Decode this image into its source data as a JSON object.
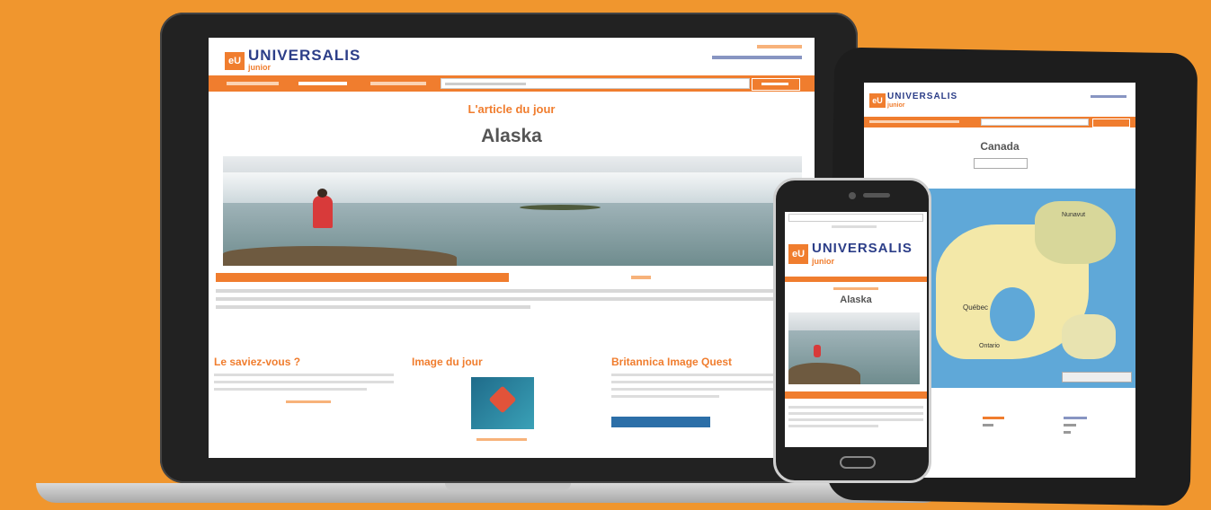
{
  "laptop": {
    "brand": "UNIVERSALIS",
    "brand_sub": "junior",
    "logo_mark": "eU",
    "title_article": "L'article du jour",
    "title_main": "Alaska",
    "section_left": "Le saviez-vous ?",
    "section_mid": "Image du jour",
    "section_right": "Britannica Image Quest"
  },
  "tablet": {
    "brand": "UNIVERSALIS",
    "brand_sub": "junior",
    "logo_mark": "eU",
    "title_main": "Canada",
    "map_label_1": "Québec",
    "map_label_2": "Ontario",
    "map_label_3": "Nunavut"
  },
  "phone": {
    "brand": "UNIVERSALIS",
    "brand_sub": "junior",
    "logo_mark": "eU",
    "title_main": "Alaska"
  },
  "colors": {
    "background": "#f0962e",
    "accent": "#f07d2e",
    "brand": "#2c3e88"
  }
}
